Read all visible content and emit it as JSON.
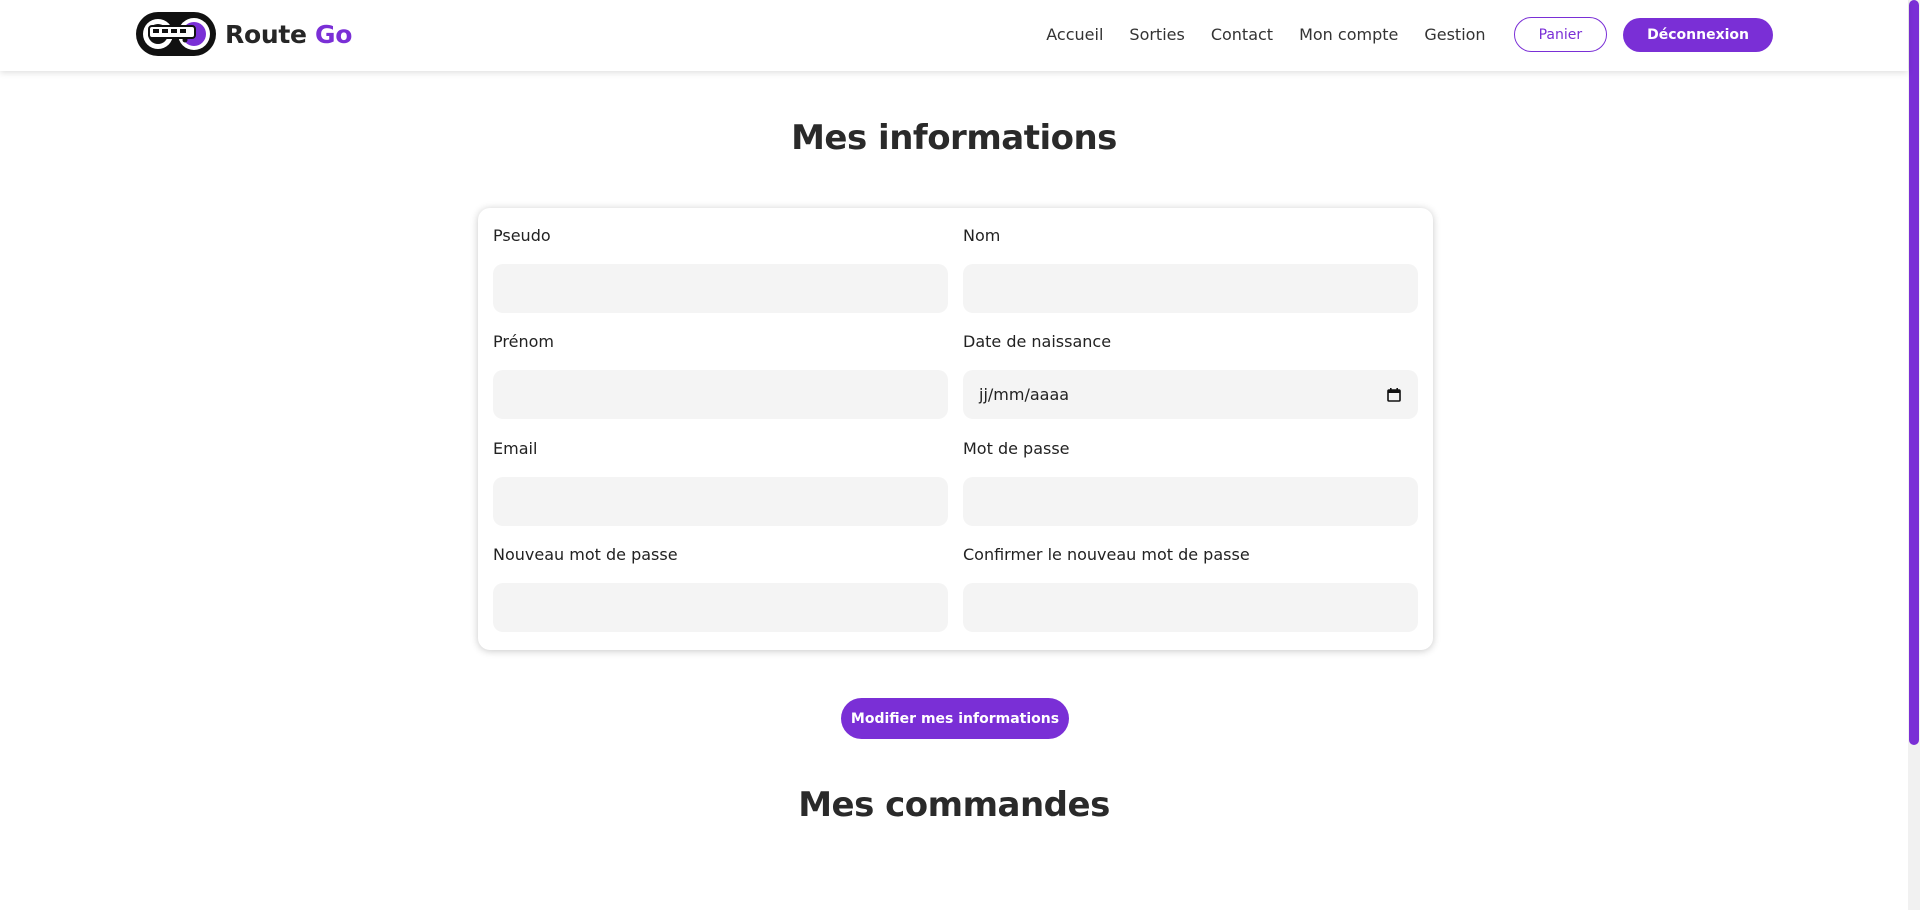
{
  "brand": {
    "name_part1": "Route",
    "name_part2": "Go",
    "accent_color": "#7a2fd6"
  },
  "nav": {
    "links": [
      "Accueil",
      "Sorties",
      "Contact",
      "Mon compte",
      "Gestion"
    ],
    "cart_label": "Panier",
    "logout_label": "Déconnexion"
  },
  "page": {
    "title": "Mes informations",
    "orders_title": "Mes commandes"
  },
  "form": {
    "pseudo_label": "Pseudo",
    "pseudo_value": "",
    "nom_label": "Nom",
    "nom_value": "",
    "prenom_label": "Prénom",
    "prenom_value": "",
    "birth_label": "Date de naissance",
    "birth_placeholder": "jj/mm/aaaa",
    "email_label": "Email",
    "email_value": "",
    "password_label": "Mot de passe",
    "password_value": "",
    "new_password_label": "Nouveau mot de passe",
    "new_password_value": "",
    "confirm_password_label": "Confirmer le nouveau mot de passe",
    "confirm_password_value": "",
    "submit_label": "Modifier mes informations"
  }
}
